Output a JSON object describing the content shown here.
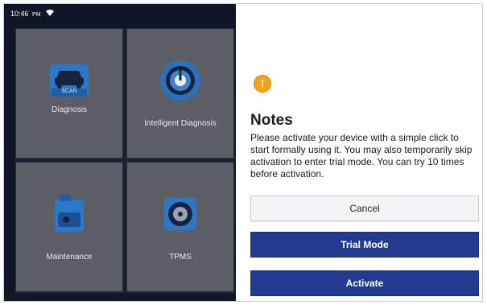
{
  "status_bar": {
    "time": "10:46",
    "indicator": "PM",
    "wifi_icon": "wifi-icon"
  },
  "tiles": [
    {
      "label": "Diagnosis",
      "icon": "car-scan-icon",
      "badge": "SCAN"
    },
    {
      "label": "Intelligent Diagnosis",
      "icon": "gauge-icon"
    },
    {
      "label": "Maintenance",
      "icon": "oil-can-icon"
    },
    {
      "label": "TPMS",
      "icon": "tire-icon"
    }
  ],
  "dialog": {
    "icon": "warning-icon",
    "icon_glyph": "!",
    "title": "Notes",
    "message": "Please activate your device with a simple click to start formally using it. You may also temporarily skip activation to enter trial mode. You can try 10 times before activation.",
    "buttons": {
      "cancel": "Cancel",
      "trial": "Trial Mode",
      "activate": "Activate"
    }
  },
  "colors": {
    "primary": "#223b91",
    "warning": "#f2a213",
    "tile": "#5c5e66",
    "background": "#0e1628"
  }
}
